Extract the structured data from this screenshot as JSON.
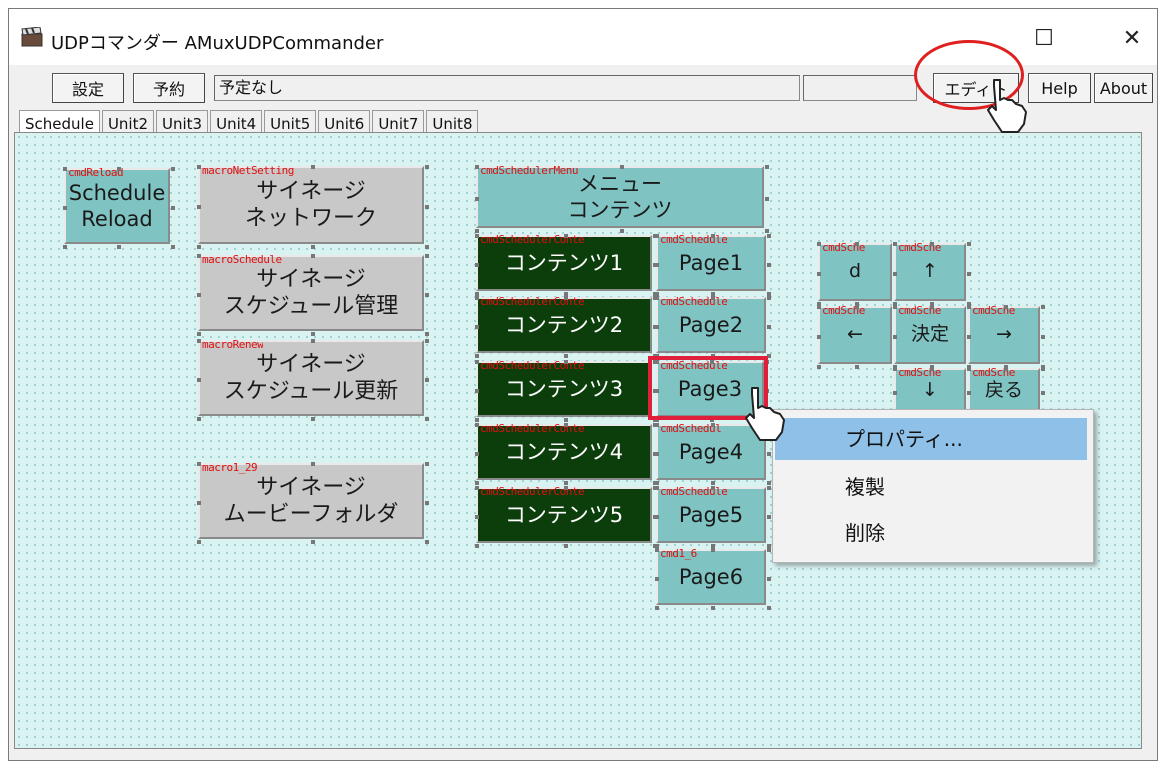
{
  "window": {
    "title": "UDPコマンダー AMuxUDPCommander",
    "maximize_glyph": "☐",
    "close_glyph": "✕"
  },
  "toolbar": {
    "settings_label": "設定",
    "reserve_label": "予約",
    "status_text": "予定なし",
    "extra_field_value": "",
    "edit_label": "エディト",
    "help_label": "Help",
    "about_label": "About"
  },
  "tabs": [
    "Schedule",
    "Unit2",
    "Unit3",
    "Unit4",
    "Unit5",
    "Unit6",
    "Unit7",
    "Unit8"
  ],
  "controls": {
    "reload": {
      "name": "cmdReload",
      "lines": [
        "Schedule",
        "Reload"
      ]
    },
    "net": {
      "name": "macroNetSetting",
      "lines": [
        "サイネージ",
        "ネットワーク"
      ]
    },
    "sched": {
      "name": "macroSchedule",
      "lines": [
        "サイネージ",
        "スケジュール管理"
      ]
    },
    "renew": {
      "name": "macroRenew",
      "lines": [
        "サイネージ",
        "スケジュール更新"
      ]
    },
    "movie": {
      "name": "macro1_29",
      "lines": [
        "サイネージ",
        "ムービーフォルダ"
      ]
    },
    "menu": {
      "name": "cmdSchedulerMenu",
      "lines": [
        "メニュー",
        "コンテンツ"
      ]
    },
    "contents": [
      {
        "name": "cmdSchedulerConte",
        "text": "コンテンツ1"
      },
      {
        "name": "cmdSchedulerConte",
        "text": "コンテンツ2"
      },
      {
        "name": "cmdSchedulerConte",
        "text": "コンテンツ3"
      },
      {
        "name": "cmdSchedulerConte",
        "text": "コンテンツ4"
      },
      {
        "name": "cmdSchedulerConte",
        "text": "コンテンツ5"
      }
    ],
    "pages": [
      {
        "name": "cmdSchedule",
        "text": "Page1"
      },
      {
        "name": "cmdSchedule",
        "text": "Page2"
      },
      {
        "name": "cmdSchedule",
        "text": "Page3"
      },
      {
        "name": "cmdSchedul",
        "text": "Page4"
      },
      {
        "name": "cmdSchedule",
        "text": "Page5"
      },
      {
        "name": "cmd1_6",
        "text": "Page6"
      }
    ],
    "nav": {
      "d": {
        "name": "cmdSche",
        "text": "d"
      },
      "up": {
        "name": "cmdSche",
        "text": "↑"
      },
      "left": {
        "name": "cmdSche",
        "text": "←"
      },
      "ok": {
        "name": "cmdSche",
        "text": "決定"
      },
      "right": {
        "name": "cmdSche",
        "text": "→"
      },
      "down": {
        "name": "cmdSche",
        "text": "↓"
      },
      "back": {
        "name": "cmdSche",
        "text": "戻る"
      }
    }
  },
  "context_menu": {
    "items": [
      "プロパティ...",
      "複製",
      "削除"
    ],
    "highlighted": "プロパティ..."
  },
  "colors": {
    "canvas_bg": "#d9f3f3",
    "teal_button": "#7fc3c3",
    "gray_button": "#c8c8c8",
    "dark_button": "#0c3e0c",
    "label_red": "#e01010",
    "menu_highlight": "#8fc1e8",
    "annotation_red": "#e02020"
  }
}
